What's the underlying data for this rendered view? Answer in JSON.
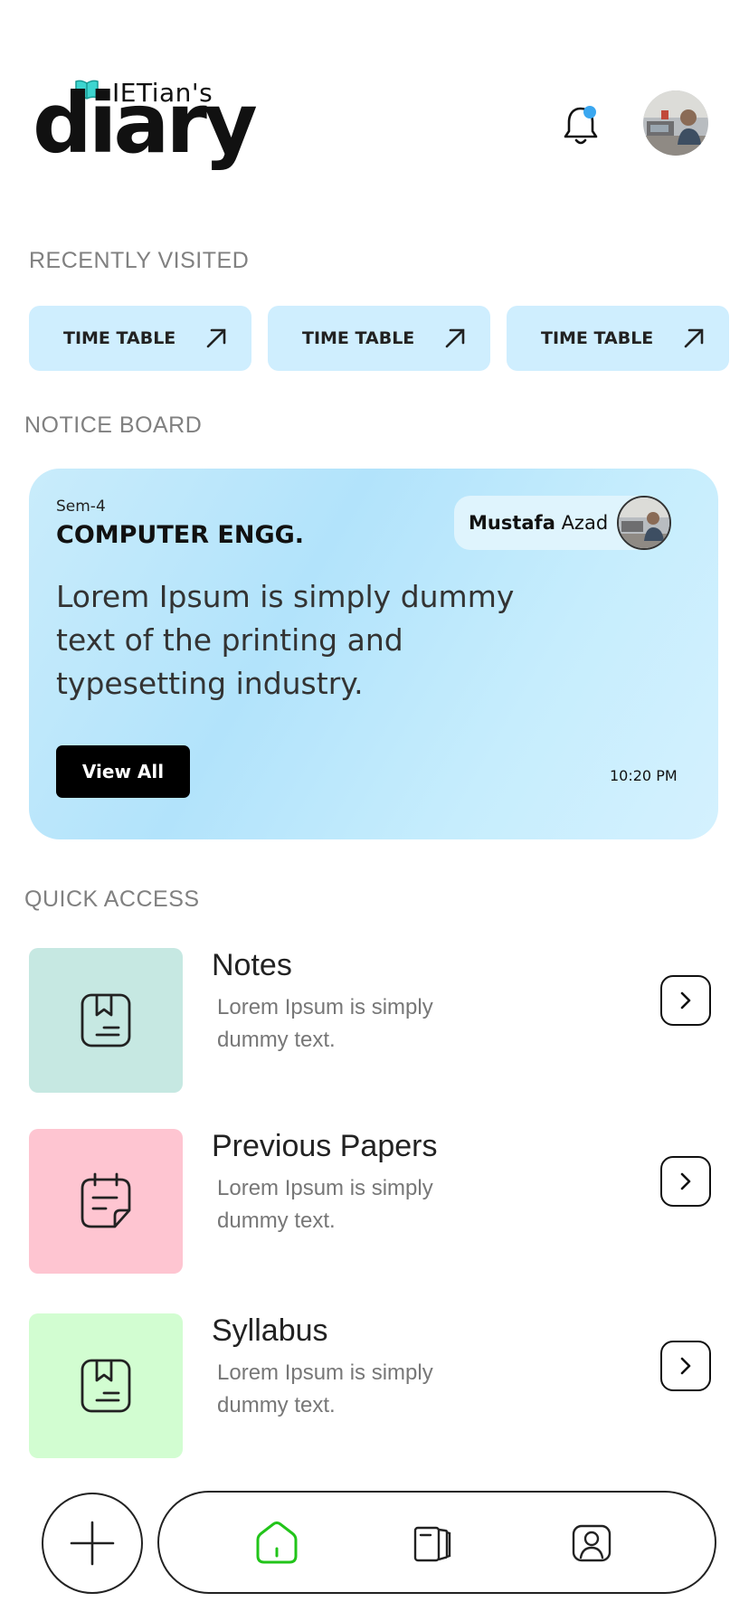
{
  "header": {
    "logo_small": "IETian's",
    "logo_big": "diary",
    "notification_dot_color": "#3aa7f0"
  },
  "recently_visited": {
    "title": "RECENTLY VISITED",
    "items": [
      {
        "label": "TIME TABLE"
      },
      {
        "label": "TIME TABLE"
      },
      {
        "label": "TIME TABLE"
      }
    ]
  },
  "notice_board": {
    "title": "NOTICE BOARD",
    "semester": "Sem-4",
    "department": "COMPUTER ENGG.",
    "author_first": "Mustafa",
    "author_last": "Azad",
    "body": "Lorem Ipsum is simply dummy text of the printing and typesetting industry.",
    "button_label": "View All",
    "time": "10:20 PM"
  },
  "quick_access": {
    "title": "QUICK ACCESS",
    "items": [
      {
        "title": "Notes",
        "desc": "Lorem Ipsum is simply dummy text.",
        "color": "#c6e8e2",
        "icon": "bookmark-book-icon"
      },
      {
        "title": "Previous Papers",
        "desc": "Lorem Ipsum is simply dummy text.",
        "color": "#fec5d1",
        "icon": "calendar-note-icon"
      },
      {
        "title": "Syllabus",
        "desc": "Lorem Ipsum is simply dummy text.",
        "color": "#d2fdd1",
        "icon": "bookmark-book-icon"
      }
    ]
  },
  "bottom_nav": {
    "active_color": "#22c41a",
    "items": [
      "home-icon",
      "books-icon",
      "profile-icon"
    ]
  }
}
